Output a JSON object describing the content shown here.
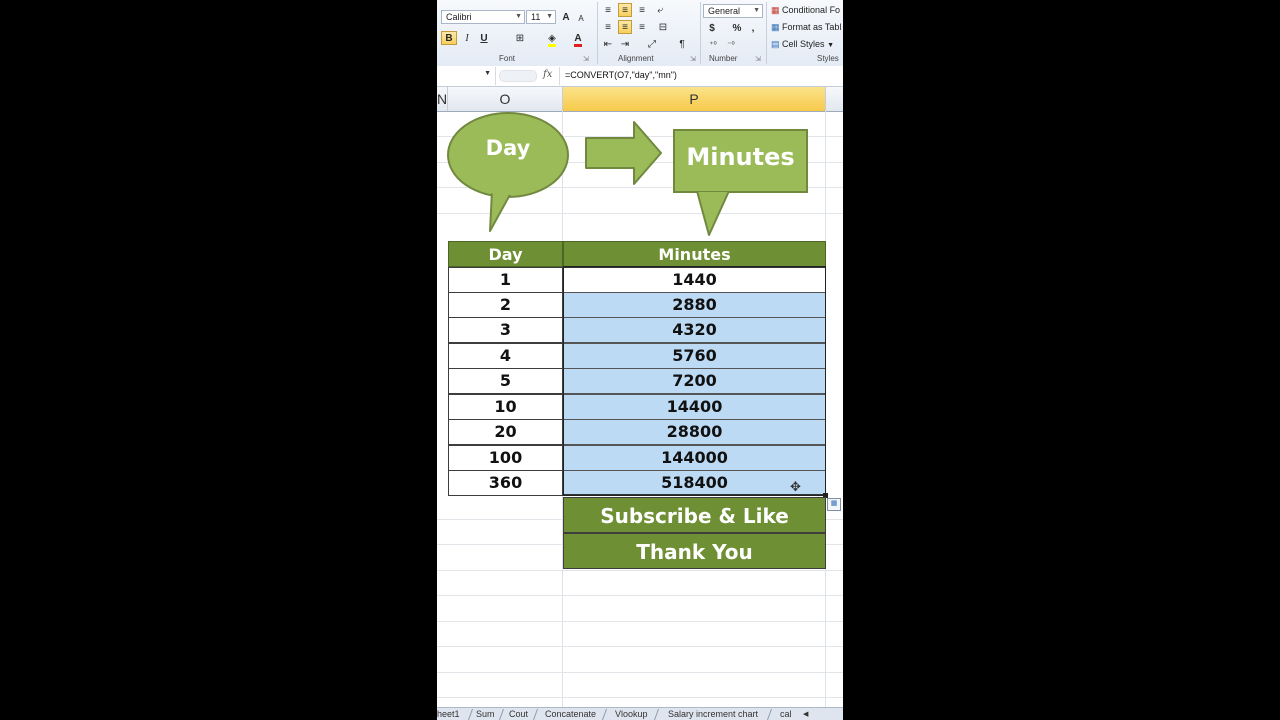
{
  "ribbon": {
    "font_name": "Calibri",
    "font_size": "11",
    "number_format": "General",
    "bold_label": "B",
    "italic_label": "I",
    "underline_label": "U",
    "grow_font": "A",
    "shrink_font": "A",
    "font_color_label": "A",
    "currency_symbol": "$",
    "percent_symbol": "%",
    "comma_symbol": ",",
    "conditional_formatting": "Conditional Fo",
    "format_as_table": "Format as Tabl",
    "cell_styles": "Cell Styles",
    "groups": {
      "font": "Font",
      "alignment": "Alignment",
      "number": "Number",
      "styles": "Styles"
    }
  },
  "formula_bar": {
    "fx": "fx",
    "formula": "=CONVERT(O7,\"day\",\"mn\")"
  },
  "columns": [
    "N",
    "O",
    "P"
  ],
  "callouts": {
    "left": "Day",
    "right": "Minutes"
  },
  "table": {
    "headers": [
      "Day",
      "Minutes"
    ],
    "rows": [
      [
        "1",
        "1440"
      ],
      [
        "2",
        "2880"
      ],
      [
        "3",
        "4320"
      ],
      [
        "4",
        "5760"
      ],
      [
        "5",
        "7200"
      ],
      [
        "10",
        "14400"
      ],
      [
        "20",
        "28800"
      ],
      [
        "100",
        "144000"
      ],
      [
        "360",
        "518400"
      ]
    ]
  },
  "banners": {
    "subscribe": "Subscribe & Like",
    "thanks": "Thank  You"
  },
  "sheet_tabs": [
    "heet1",
    "Sum",
    "Cout",
    "Concatenate",
    "Vlookup",
    "Salary increment chart",
    "cal"
  ],
  "colors": {
    "header_green": "#6f8f34",
    "callout_green": "#9bbb59",
    "selection_blue": "#bcdaf3",
    "selected_col_header": "#f6c94a"
  }
}
